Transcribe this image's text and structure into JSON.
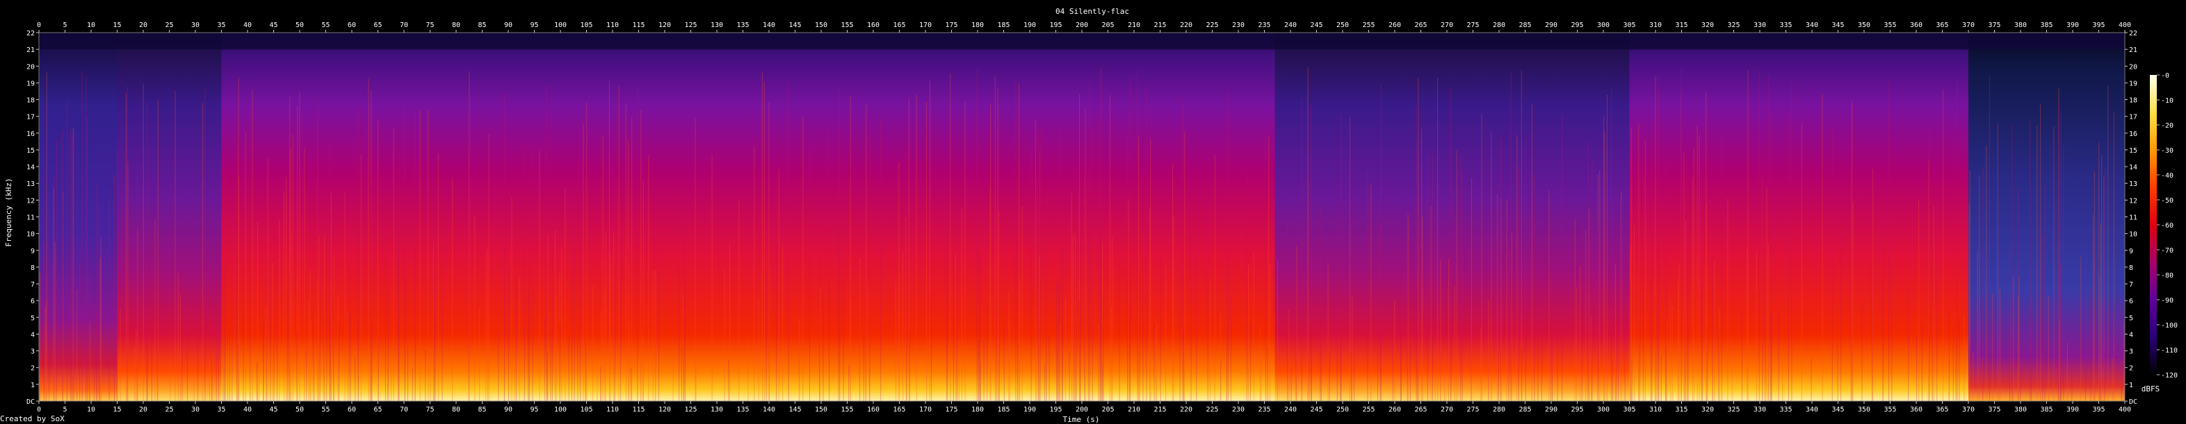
{
  "chart_data": {
    "type": "heatmap",
    "title": "04 Silently-flac",
    "xlabel": "Time (s)",
    "ylabel": "Frequency (kHz)",
    "xlim": [
      0,
      400
    ],
    "ylim": [
      0,
      22
    ],
    "x_ticks": [
      0,
      5,
      10,
      15,
      20,
      25,
      30,
      35,
      40,
      45,
      50,
      55,
      60,
      65,
      70,
      75,
      80,
      85,
      90,
      95,
      100,
      105,
      110,
      115,
      120,
      125,
      130,
      135,
      140,
      145,
      150,
      155,
      160,
      165,
      170,
      175,
      180,
      185,
      190,
      195,
      200,
      205,
      210,
      215,
      220,
      225,
      230,
      235,
      240,
      245,
      250,
      255,
      260,
      265,
      270,
      275,
      280,
      285,
      290,
      295,
      300,
      305,
      310,
      315,
      320,
      325,
      330,
      335,
      340,
      345,
      350,
      355,
      360,
      365,
      370,
      375,
      380,
      385,
      390,
      395,
      400
    ],
    "y_ticks": [
      "DC",
      "1",
      "2",
      "3",
      "4",
      "5",
      "6",
      "7",
      "8",
      "9",
      "10",
      "11",
      "12",
      "13",
      "14",
      "15",
      "16",
      "17",
      "18",
      "19",
      "20",
      "21",
      "22"
    ],
    "colorbar": {
      "label": "dBFS",
      "ticks": [
        "-0",
        "-10",
        "-20",
        "-30",
        "-40",
        "-50",
        "-60",
        "-70",
        "-80",
        "-90",
        "-100",
        "-110",
        "-120"
      ],
      "colors": [
        "#fffff0",
        "#ffe04a",
        "#ff9a00",
        "#ff3c00",
        "#e00010",
        "#a8006a",
        "#60009a",
        "#2a0078",
        "#000000"
      ]
    },
    "grid": false,
    "segments": [
      {
        "start": 0,
        "end": 15,
        "level": "quiet"
      },
      {
        "start": 15,
        "end": 35,
        "level": "medium"
      },
      {
        "start": 35,
        "end": 237,
        "level": "loud"
      },
      {
        "start": 237,
        "end": 305,
        "level": "medium"
      },
      {
        "start": 305,
        "end": 370,
        "level": "loud"
      },
      {
        "start": 370,
        "end": 400,
        "level": "fading"
      }
    ]
  },
  "footer": {
    "credit": "Created by SoX"
  }
}
